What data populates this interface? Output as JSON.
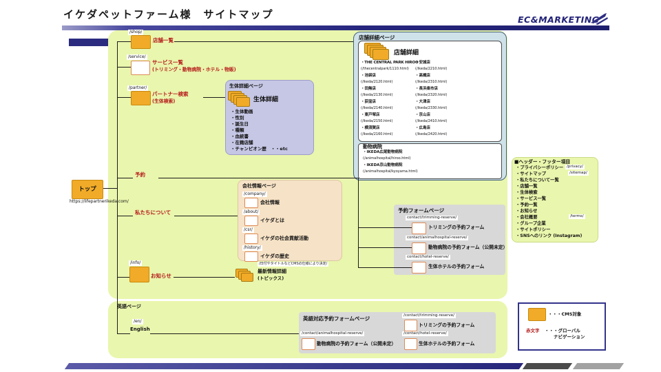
{
  "page": {
    "title": "イケダペットファーム様　サイトマップ",
    "logo": "EC&MARKETING"
  },
  "top": {
    "label": "トップ",
    "url": "https://lifepartnerikeda.com/"
  },
  "nav": {
    "shop": {
      "path": "/shop/",
      "label": "店舗一覧"
    },
    "service": {
      "path": "/service/",
      "label": "サービス一覧",
      "sub": "(トリミング・動物病院・ホテル・物販)"
    },
    "partner": {
      "path": "/partner/",
      "label": "パートナー検索",
      "sub": "(生体検索)"
    },
    "reserve": {
      "label": "予約"
    },
    "about": {
      "label": "私たちについて"
    },
    "info": {
      "path": "/info/",
      "label": "お知らせ"
    },
    "english": {
      "path": "/en/",
      "label": "English"
    }
  },
  "store_detail": {
    "page_title": "店舗詳細ページ",
    "title": "店舗詳細",
    "left": [
      {
        "name": "・THE CENTRAL PARK HIROO",
        "url": "(/thecentralpark/1110.html)"
      },
      {
        "name": "・池袋店",
        "url": "(/ikeda/2120.html)"
      },
      {
        "name": "・田無店",
        "url": "(/ikeda/2130.html)"
      },
      {
        "name": "・荻窪店",
        "url": "(/ikeda/2140.html)"
      },
      {
        "name": "・東戸塚店",
        "url": "(/ikeda/2150.html)"
      },
      {
        "name": "・横須賀店",
        "url": "(/ikeda/2160.html)"
      }
    ],
    "right": [
      {
        "name": "・安城店",
        "url": "(/ikeda/2210.html)"
      },
      {
        "name": "・高槻店",
        "url": "(/ikeda/2310.html)"
      },
      {
        "name": "・長浜楽市店",
        "url": "(/ikeda/2320.html)"
      },
      {
        "name": "・大津店",
        "url": "(/ikeda/2330.html)"
      },
      {
        "name": "・京山店",
        "url": "(/ikeda/2410.html)"
      },
      {
        "name": "・広島店",
        "url": "(/ikeda/2420.html)"
      }
    ],
    "hospital": {
      "title": "動物病院",
      "items": [
        {
          "name": "・IKEDA広尾動物病院",
          "url": "(/animalhospital/hiroo.html)"
        },
        {
          "name": "・IKEDA京山動物病院",
          "url": "(/animalhospital/kyoyama.html)"
        }
      ]
    }
  },
  "pet_detail": {
    "page_title": "生体詳細ページ",
    "title": "生体詳細",
    "items": [
      "・生体動画",
      "・性別",
      "・誕生日",
      "・種類",
      "・血統書",
      "・在籍店舗",
      "・チャンピオン歴　・・etc"
    ]
  },
  "company": {
    "page_title": "会社情報ページ",
    "items": [
      {
        "path": "/company/",
        "label": "会社情報"
      },
      {
        "path": "/about/",
        "label": "イケダとは"
      },
      {
        "path": "/csr/",
        "label": "イケダの社会貢献活動"
      },
      {
        "path": "/history/",
        "label": "イケダの歴史"
      }
    ]
  },
  "reserve_forms": {
    "page_title": "予約フォームページ",
    "items": [
      {
        "path": "contact/trimming-reserve/",
        "label": "トリミングの予約フォーム"
      },
      {
        "path": "contact/animalhospital-reserve/",
        "label": "動物病院の予約フォーム（公開未定）"
      },
      {
        "path": "contact/hotel-reserve/",
        "label": "生体ホテルの予約フォーム"
      }
    ]
  },
  "news_detail": {
    "note": "/日付やタイトルなどCMSの仕様により決定/",
    "title": "最新情報詳細",
    "sub": "(トピックス)"
  },
  "english_page": {
    "title": "英語ページ",
    "forms_title": "英語対応予約フォームページ",
    "items": [
      {
        "path": "/contact/trimming-reserve/",
        "label": "トリミングの予約フォーム"
      },
      {
        "path": "/contact/animalhospital-reserve/",
        "label": "動物病院の予約フォーム（公開未定）"
      },
      {
        "path": "/contact/hotel-reserve/",
        "label": "生体ホテルの予約フォーム"
      }
    ]
  },
  "header_footer": {
    "title": "■ヘッダー・フッター項目",
    "items": [
      {
        "label": "・プライバシーポリシー",
        "path": "/privacy/"
      },
      {
        "label": "・サイトマップ",
        "path": "/sitemap/"
      },
      {
        "label": "・私たちについて一覧"
      },
      {
        "label": "・店舗一覧"
      },
      {
        "label": "・生体検索"
      },
      {
        "label": "・サービス一覧"
      },
      {
        "label": "・予約一覧"
      },
      {
        "label": "・お知らせ"
      },
      {
        "label": "・会社概要",
        "path": "/terms/"
      },
      {
        "label": "・グループ企業"
      },
      {
        "label": "・サイトポリシー"
      },
      {
        "label": "・SNSへのリンク (Instagram)"
      }
    ]
  },
  "legend": {
    "cms": "・・・CMS対象",
    "red_sample": "赤文字",
    "red_desc_1": "・・・グローバル",
    "red_desc_2": "ナビゲーション"
  },
  "colors": {
    "cms_orange": "#f1ab28",
    "global_nav_red": "#b51a1a",
    "bar_navy": "#2e2e85",
    "area_green": "#e9f6ad"
  }
}
